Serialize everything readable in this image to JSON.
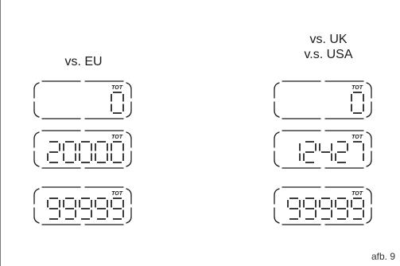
{
  "figure": {
    "label": "afb. 9"
  },
  "columns": [
    {
      "heading_lines": [
        "vs. EU"
      ],
      "displays": [
        {
          "indicator": "TOT",
          "value": "0"
        },
        {
          "indicator": "TOT",
          "value": "20000"
        },
        {
          "indicator": "TOT",
          "value": "99999"
        }
      ]
    },
    {
      "heading_lines": [
        "vs. UK",
        "v.s. USA"
      ],
      "displays": [
        {
          "indicator": "TOT",
          "value": "0"
        },
        {
          "indicator": "TOT",
          "value": "12427"
        },
        {
          "indicator": "TOT",
          "value": "99999"
        }
      ]
    }
  ],
  "colors": {
    "ink": "#1a1a1a",
    "frame": "#7a7a7a"
  }
}
